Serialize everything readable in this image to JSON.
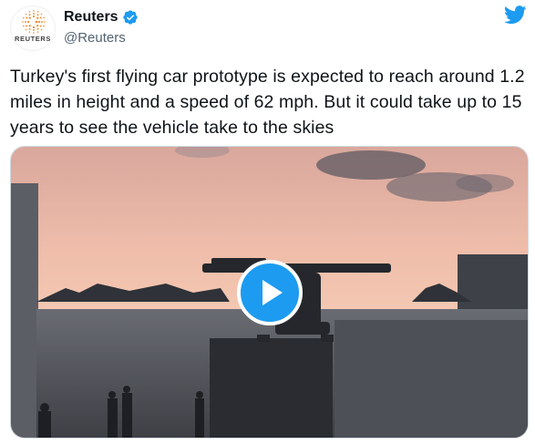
{
  "author": {
    "display_name": "Reuters",
    "handle": "@Reuters",
    "avatar_text": "REUTERS",
    "verified": true,
    "avatar_icon": "reuters-dot-logo",
    "verified_icon": "verified-badge-icon",
    "platform_icon": "twitter-bird-icon"
  },
  "tweet": {
    "text": "Turkey's first flying car prototype is expected to reach around 1.2 miles in height and a speed of 62 mph. But it could take up to 15 years to see the vehicle take to the skies"
  },
  "media": {
    "type": "video",
    "play_icon": "play-icon"
  },
  "colors": {
    "accent": "#1d9bf0",
    "handle": "#536471",
    "reuters_orange": "#f28c28"
  }
}
